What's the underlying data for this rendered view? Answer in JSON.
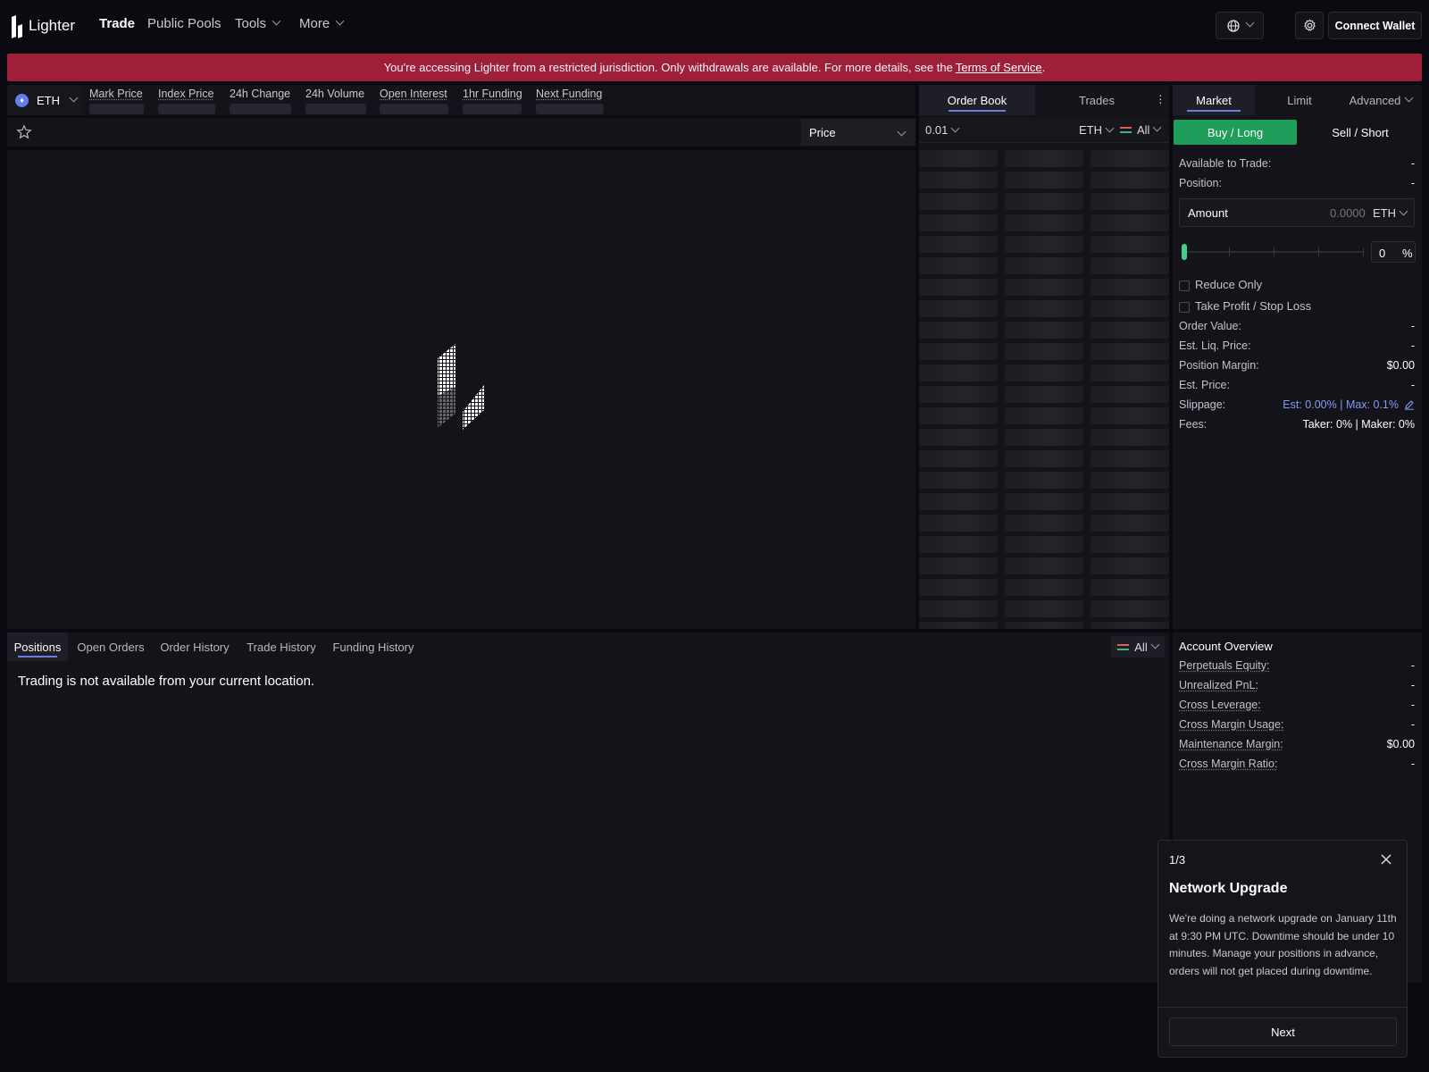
{
  "header": {
    "logo_text": "Lighter",
    "nav": [
      {
        "label": "Trade"
      },
      {
        "label": "Public Pools"
      },
      {
        "label": "Tools"
      },
      {
        "label": "More"
      }
    ],
    "connect_wallet": "Connect Wallet"
  },
  "banner": {
    "text": "You're accessing Lighter from a restricted jurisdiction. Only withdrawals are available. For more details, see the",
    "link": "Terms of Service",
    "suffix": "."
  },
  "market": {
    "symbol": "ETH",
    "stats": [
      "Mark Price",
      "Index Price",
      "24h Change",
      "24h Volume",
      "Open Interest",
      "1hr Funding",
      "Next Funding"
    ]
  },
  "chart": {
    "price_select": "Price"
  },
  "orderbook": {
    "tabs": [
      "Order Book",
      "Trades"
    ],
    "tick": "0.01",
    "unit": "ETH",
    "filter": "All"
  },
  "form": {
    "types": [
      "Market",
      "Limit",
      "Advanced"
    ],
    "buy": "Buy / Long",
    "sell": "Sell / Short",
    "available_label": "Available to Trade:",
    "available_value": "-",
    "position_label": "Position:",
    "position_value": "-",
    "amount_label": "Amount",
    "amount_value": "0.0000",
    "amount_unit": "ETH",
    "percent_value": "0",
    "percent_sign": "%",
    "slider_level": 0,
    "reduce_only": "Reduce Only",
    "tpsl": "Take Profit / Stop Loss",
    "rows": [
      {
        "label": "Order Value:",
        "value": "-"
      },
      {
        "label": "Est. Liq. Price:",
        "value": "-"
      },
      {
        "label": "Position Margin:",
        "value": "$0.00"
      },
      {
        "label": "Est. Price:",
        "value": "-"
      }
    ],
    "slippage_label": "Slippage:",
    "slippage_value": "Est: 0.00% | Max: 0.1%",
    "fees_label": "Fees:",
    "fees_value": "Taker: 0% | Maker: 0%"
  },
  "bottom": {
    "tabs": [
      "Positions",
      "Open Orders",
      "Order History",
      "Trade History",
      "Funding History"
    ],
    "filter": "All",
    "message": "Trading is not available from your current location."
  },
  "account": {
    "title": "Account Overview",
    "rows": [
      {
        "label": "Perpetuals Equity:",
        "value": "-"
      },
      {
        "label": "Unrealized PnL:",
        "value": "-"
      },
      {
        "label": "Cross Leverage:",
        "value": "-"
      },
      {
        "label": "Cross Margin Usage:",
        "value": "-"
      },
      {
        "label": "Maintenance Margin:",
        "value": "$0.00"
      },
      {
        "label": "Cross Margin Ratio:",
        "value": "-"
      }
    ]
  },
  "popup": {
    "step": "1/3",
    "title": "Network Upgrade",
    "body": "We're doing a network upgrade on January 11th at 9:30 PM UTC. Downtime should be under 10 minutes. Manage your positions in advance, orders will not get placed during downtime.",
    "next": "Next"
  },
  "colors": {
    "banner": "#9e2038",
    "buy": "#1f9d5a",
    "accent": "#6b7ce6",
    "link_blue": "#7f9cf5"
  }
}
